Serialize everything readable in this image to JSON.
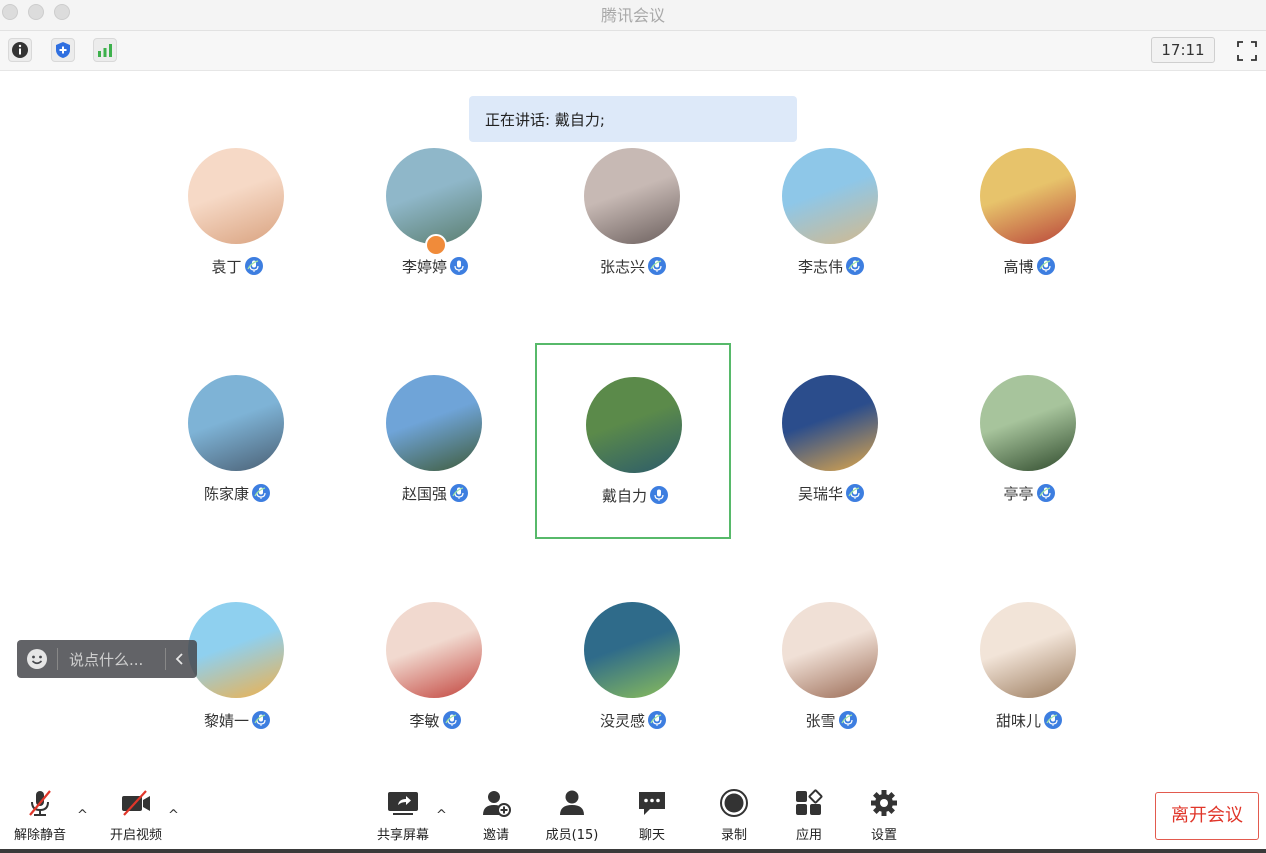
{
  "window": {
    "title": "腾讯会议"
  },
  "toolbar": {
    "clock": "17:11"
  },
  "speaking": {
    "text": "正在讲话: 戴自力;"
  },
  "participants": [
    {
      "name": "袁丁",
      "mic": "speaking",
      "host": false,
      "colors": [
        "#f6d9c6",
        "#d9a27f"
      ]
    },
    {
      "name": "李婷婷",
      "mic": "on",
      "host": true,
      "colors": [
        "#8fb7c9",
        "#5a7d6e"
      ]
    },
    {
      "name": "张志兴",
      "mic": "speaking",
      "host": false,
      "colors": [
        "#c7b9b4",
        "#6b5f5d"
      ]
    },
    {
      "name": "李志伟",
      "mic": "speaking",
      "host": false,
      "colors": [
        "#8ec7e8",
        "#d4b98c"
      ]
    },
    {
      "name": "高博",
      "mic": "speaking",
      "host": false,
      "colors": [
        "#e7c36b",
        "#b9443a"
      ]
    },
    {
      "name": "陈家康",
      "mic": "speaking",
      "host": false,
      "colors": [
        "#7eb3d6",
        "#4a5f73"
      ]
    },
    {
      "name": "赵国强",
      "mic": "speaking",
      "host": false,
      "colors": [
        "#6fa4d8",
        "#3f5b3a"
      ]
    },
    {
      "name": "戴自力",
      "mic": "on",
      "host": false,
      "active": true,
      "colors": [
        "#5b8a4a",
        "#2c5b6b"
      ]
    },
    {
      "name": "吴瑞华",
      "mic": "speaking",
      "host": false,
      "colors": [
        "#2b4d8c",
        "#e0a84b"
      ]
    },
    {
      "name": "亭亭",
      "mic": "speaking",
      "host": false,
      "colors": [
        "#a7c49c",
        "#2f4a2c"
      ]
    },
    {
      "name": "黎婧一",
      "mic": "speaking",
      "host": false,
      "colors": [
        "#8fd0ef",
        "#f0b04a"
      ]
    },
    {
      "name": "李敏",
      "mic": "speaking",
      "host": false,
      "colors": [
        "#f1d9cf",
        "#c2433c"
      ]
    },
    {
      "name": "没灵感",
      "mic": "speaking",
      "host": false,
      "colors": [
        "#2f6b8a",
        "#8cbf5a"
      ]
    },
    {
      "name": "张雪",
      "mic": "speaking",
      "host": false,
      "colors": [
        "#f0e0d6",
        "#9a6a54"
      ]
    },
    {
      "name": "甜味儿",
      "mic": "speaking",
      "host": false,
      "colors": [
        "#f2e4d8",
        "#9a7a5c"
      ]
    }
  ],
  "chat": {
    "placeholder": "说点什么...",
    "emoji_icon": "smile-icon",
    "collapse_icon": "chevron-left-icon"
  },
  "controls": {
    "unmute": "解除静音",
    "start_video": "开启视频",
    "share_screen": "共享屏幕",
    "invite": "邀请",
    "members": "成员(15)",
    "chat": "聊天",
    "record": "录制",
    "apps": "应用",
    "settings": "设置",
    "leave": "离开会议"
  },
  "colors": {
    "accent": "#3d7ee0",
    "active_border": "#57b96a",
    "leave": "#e0362a",
    "banner": "#dde9f9"
  }
}
